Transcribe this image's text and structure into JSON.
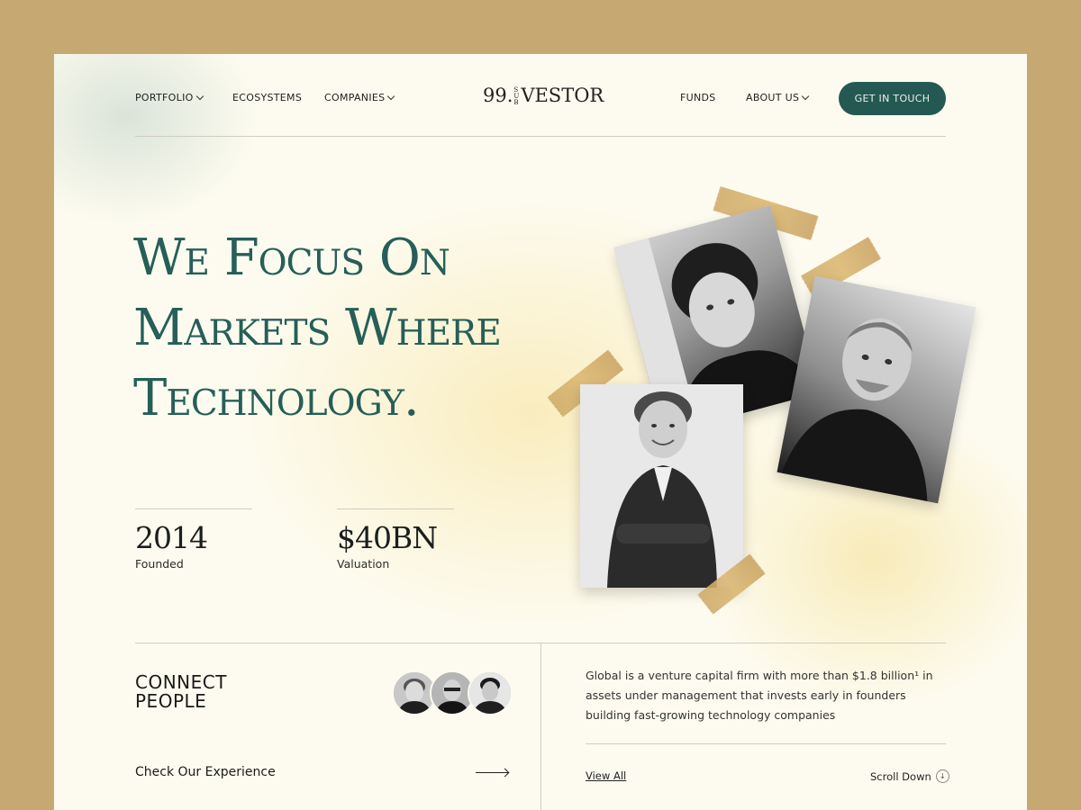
{
  "nav": {
    "left": [
      {
        "label": "PORTFOLIO",
        "dropdown": true
      },
      {
        "label": "ECOSYSTEMS",
        "dropdown": false
      },
      {
        "label": "COMPANIES",
        "dropdown": true
      }
    ],
    "right": [
      {
        "label": "FUNDS",
        "dropdown": false
      },
      {
        "label": "ABOUT US",
        "dropdown": true
      }
    ],
    "cta_label": "GET IN TOUCH"
  },
  "logo": {
    "prefix": "99.",
    "sub_top": "S",
    "sub_mid": "U",
    "sub_bot": "B",
    "suffix": "VESTOR"
  },
  "hero": {
    "line1": "We Focus On",
    "line2": "Markets Where",
    "line3": "Technology."
  },
  "stats": [
    {
      "value": "2014",
      "label": "Founded"
    },
    {
      "value": "$40BN",
      "label": "Valuation"
    }
  ],
  "connect": {
    "title_line1": "CONNECT",
    "title_line2": "PEOPLE",
    "experience_label": "Check Our Experience"
  },
  "about": {
    "description": "Global is a venture capital firm with more than $1.8 billion¹ in assets under management that invests early in founders building fast-growing technology companies",
    "view_all": "View All",
    "scroll_down": "Scroll Down"
  },
  "colors": {
    "outer_bg": "#c6a872",
    "page_bg": "#fdfbef",
    "accent": "#245953",
    "hero_text": "#255f58",
    "tape": "#cfa866"
  }
}
